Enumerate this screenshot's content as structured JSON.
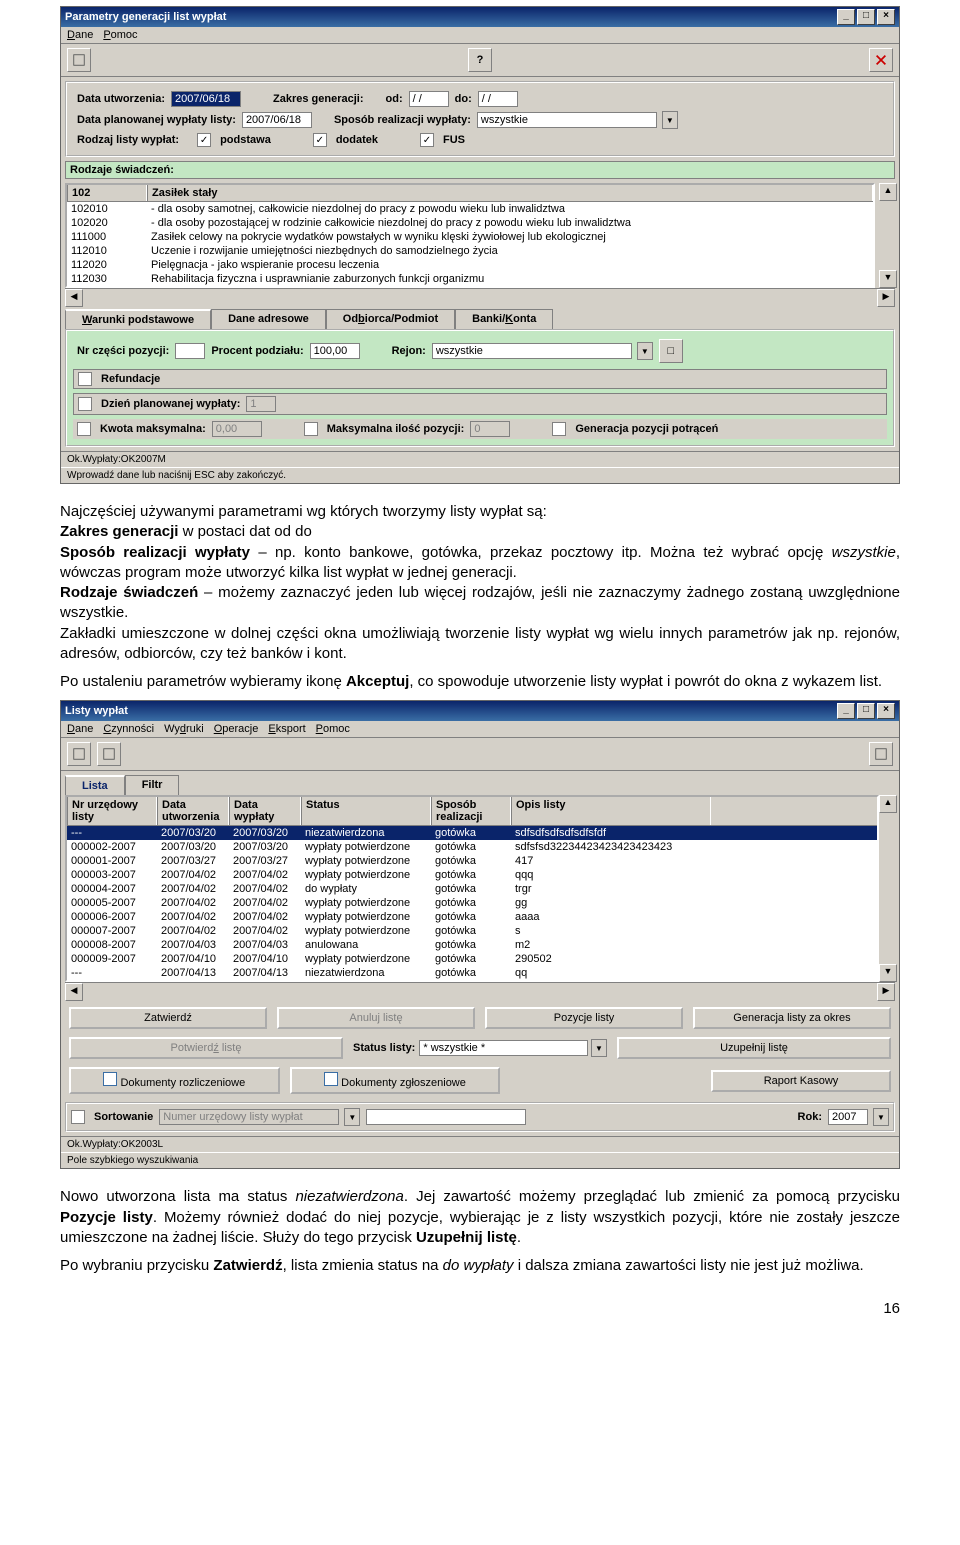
{
  "win1": {
    "title": "Parametry generacji list wypłat",
    "menu": [
      "Dane",
      "Pomoc"
    ],
    "labels": {
      "data_utw": "Data utworzenia:",
      "data_utw_val": "2007/06/18",
      "zakres": "Zakres generacji:",
      "od": "od:",
      "od_val": "/ /",
      "do": "do:",
      "do_val": "/ /",
      "data_plan": "Data planowanej wypłaty listy:",
      "data_plan_val": "2007/06/18",
      "sposob": "Sposób realizacji wypłaty:",
      "sposob_val": "wszystkie",
      "rodzaj": "Rodzaj listy wypłat:",
      "ch_podstawa": "podstawa",
      "ch_dodatek": "dodatek",
      "ch_fus": "FUS"
    },
    "rs_head": "Rodzaje świadczeń:",
    "rs_cols": [
      "102",
      "Zasiłek stały"
    ],
    "rs_rows": [
      [
        "102010",
        "- dla osoby samotnej, całkowicie niezdolnej do pracy z powodu wieku lub inwalidztwa"
      ],
      [
        "102020",
        "- dla osoby pozostającej w rodzinie całkowicie niezdolnej do pracy z powodu wieku lub inwalidztwa"
      ],
      [
        "111000",
        "Zasiłek celowy na pokrycie wydatków powstałych w wyniku klęski żywiołowej lub ekologicznej"
      ],
      [
        "112010",
        "Uczenie i rozwijanie umiejętności niezbędnych do samodzielnego życia"
      ],
      [
        "112020",
        "Pielęgnacja - jako wspieranie procesu leczenia"
      ],
      [
        "112030",
        "Rehabilitacja fizyczna i usprawnianie zaburzonych funkcji organizmu"
      ]
    ],
    "tabs": [
      "Warunki podstawowe",
      "Dane adresowe",
      "Odbiorca/Podmiot",
      "Banki/Konta"
    ],
    "wp": {
      "nr": "Nr części pozycji:",
      "nr_val": "",
      "proc": "Procent podziału:",
      "proc_val": "100,00",
      "rejon": "Rejon:",
      "rejon_val": "wszystkie",
      "ref": "Refundacje",
      "dzien": "Dzień planowanej wypłaty:",
      "dzien_val": "1",
      "kwota": "Kwota maksymalna:",
      "kwota_val": "0,00",
      "maks": "Maksymalna ilość pozycji:",
      "maks_val": "0",
      "gen": "Generacja pozycji potrąceń"
    },
    "status1": "Ok.Wypłaty:OK2007M",
    "status2": "Wprowadź dane lub naciśnij ESC aby zakończyć."
  },
  "para1_a": "Najczęściej używanymi parametrami wg których tworzymy listy wypłat są:",
  "para1_b_label": "Zakres generacji",
  "para1_b_rest": " w postaci dat od do",
  "para1_c_label": "Sposób realizacji wypłaty",
  "para1_c_rest": " – np. konto bankowe, gotówka, przekaz pocztowy itp. Można też wybrać opcję ",
  "para1_c_ital": "wszystkie",
  "para1_c_end": ", wówczas program może utworzyć kilka list wypłat w jednej generacji.",
  "para1_d_label": "Rodzaje świadczeń",
  "para1_d_rest": " – możemy zaznaczyć jeden lub więcej rodzajów, jeśli nie zaznaczymy żadnego zostaną uwzględnione wszystkie.",
  "para1_e": "Zakładki umieszczone w dolnej części okna umożliwiają tworzenie listy wypłat wg wielu innych parametrów jak np. rejonów, adresów, odbiorców, czy też banków i kont.",
  "para2_a": "Po ustaleniu parametrów wybieramy ikonę ",
  "para2_b": "Akceptuj",
  "para2_c": ", co spowoduje utworzenie listy wypłat i powrót do okna z wykazem list.",
  "win2": {
    "title": "Listy wypłat",
    "menu": [
      "Dane",
      "Czynności",
      "Wydruki",
      "Operacje",
      "Eksport",
      "Pomoc"
    ],
    "tabs": [
      "Lista",
      "Filtr"
    ],
    "cols": [
      "Nr urzędowy listy",
      "Data utworzenia",
      "Data wypłaty",
      "Status",
      "Sposób realizacji",
      "Opis listy"
    ],
    "rows": [
      [
        "---",
        "2007/03/20",
        "2007/03/20",
        "niezatwierdzona",
        "gotówka",
        "sdfsdfsdfsdfsdfsfdf"
      ],
      [
        "000002-2007",
        "2007/03/20",
        "2007/03/20",
        "wypłaty potwierdzone",
        "gotówka",
        "sdfsfsd32234423423423423423"
      ],
      [
        "000001-2007",
        "2007/03/27",
        "2007/03/27",
        "wypłaty potwierdzone",
        "gotówka",
        "417"
      ],
      [
        "000003-2007",
        "2007/04/02",
        "2007/04/02",
        "wypłaty potwierdzone",
        "gotówka",
        "qqq"
      ],
      [
        "000004-2007",
        "2007/04/02",
        "2007/04/02",
        "do wypłaty",
        "gotówka",
        "trgr"
      ],
      [
        "000005-2007",
        "2007/04/02",
        "2007/04/02",
        "wypłaty potwierdzone",
        "gotówka",
        "gg"
      ],
      [
        "000006-2007",
        "2007/04/02",
        "2007/04/02",
        "wypłaty potwierdzone",
        "gotówka",
        "aaaa"
      ],
      [
        "000007-2007",
        "2007/04/02",
        "2007/04/02",
        "wypłaty potwierdzone",
        "gotówka",
        "s"
      ],
      [
        "000008-2007",
        "2007/04/03",
        "2007/04/03",
        "anulowana",
        "gotówka",
        "m2"
      ],
      [
        "000009-2007",
        "2007/04/10",
        "2007/04/10",
        "wypłaty potwierdzone",
        "gotówka",
        "290502"
      ],
      [
        "---",
        "2007/04/13",
        "2007/04/13",
        "niezatwierdzona",
        "gotówka",
        "qq"
      ]
    ],
    "btns": {
      "zat": "Zatwierdź",
      "anul": "Anuluj listę",
      "poz": "Pozycje listy",
      "gen": "Generacja listy za okres",
      "potw": "Potwierdź listę",
      "stat_l": "Status listy:",
      "stat_v": "* wszystkie *",
      "uzu": "Uzupełnij listę",
      "dokr": "Dokumenty rozliczeniowe",
      "dokz": "Dokumenty zgłoszeniowe",
      "rap": "Raport Kasowy"
    },
    "sort": {
      "chk": "Sortowanie",
      "by": "Numer urzędowy listy wypłat",
      "rok": "Rok:",
      "rok_v": "2007"
    },
    "status1": "Ok.Wypłaty:OK2003L",
    "status2": "Pole szybkiego wyszukiwania"
  },
  "para3_a": "Nowo utworzona lista ma status ",
  "para3_ital1": "niezatwierdzona",
  "para3_b": ". Jej zawartość możemy przeglądać lub zmienić za pomocą przycisku ",
  "para3_bold1": "Pozycje listy",
  "para3_c": ". Możemy również dodać do niej pozycje, wybierając je z listy wszystkich pozycji, które nie zostały jeszcze umieszczone na żadnej liście. Służy do tego przycisk ",
  "para3_bold2": "Uzupełnij listę",
  "para3_d": ".",
  "para4_a": "Po wybraniu przycisku ",
  "para4_bold": "Zatwierdź",
  "para4_b": ", lista zmienia status na ",
  "para4_ital": "do wypłaty",
  "para4_c": " i dalsza zmiana zawartości listy nie jest już możliwa.",
  "pgnum": "16"
}
